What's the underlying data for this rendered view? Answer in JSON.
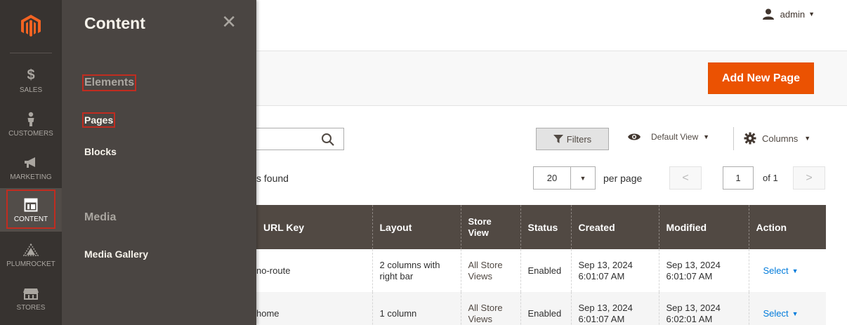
{
  "nav": {
    "items": [
      {
        "label": "SALES",
        "icon": "dollar-icon"
      },
      {
        "label": "CUSTOMERS",
        "icon": "customer-icon"
      },
      {
        "label": "MARKETING",
        "icon": "megaphone-icon"
      },
      {
        "label": "CONTENT",
        "icon": "content-layout-icon"
      },
      {
        "label": "PLUMROCKET",
        "icon": "plumrocket-icon"
      },
      {
        "label": "STORES",
        "icon": "store-icon"
      }
    ]
  },
  "flyout": {
    "title": "Content",
    "elements_heading": "Elements",
    "pages_link": "Pages",
    "blocks_link": "Blocks",
    "media_heading": "Media",
    "media_gallery_link": "Media Gallery"
  },
  "header": {
    "username": "admin",
    "add_button": "Add New Page"
  },
  "toolbar": {
    "filters": "Filters",
    "view": "Default View",
    "columns": "Columns",
    "records": "s found",
    "per_page_value": "20",
    "per_page_label": "per page",
    "page_current": "1",
    "page_of": "of 1"
  },
  "grid": {
    "columns": [
      "URL Key",
      "Layout",
      "Store View",
      "Status",
      "Created",
      "Modified",
      "Action"
    ],
    "rows": [
      {
        "url_key": "no-route",
        "layout": "2 columns with right bar",
        "store_view": "All Store Views",
        "status": "Enabled",
        "created": "Sep 13, 2024 6:01:07 AM",
        "modified": "Sep 13, 2024 6:01:07 AM",
        "action": "Select"
      },
      {
        "url_key": "home",
        "layout": "1 column",
        "store_view": "All Store Views",
        "status": "Enabled",
        "created": "Sep 13, 2024 6:01:07 AM",
        "modified": "Sep 13, 2024 6:02:01 AM",
        "action": "Select"
      }
    ]
  },
  "colors": {
    "nav_bg": "#373330",
    "flyout_bg": "#4a4542",
    "primary_button": "#eb5202",
    "grid_header": "#514943",
    "highlight": "#c12c20",
    "link": "#007bdb"
  }
}
